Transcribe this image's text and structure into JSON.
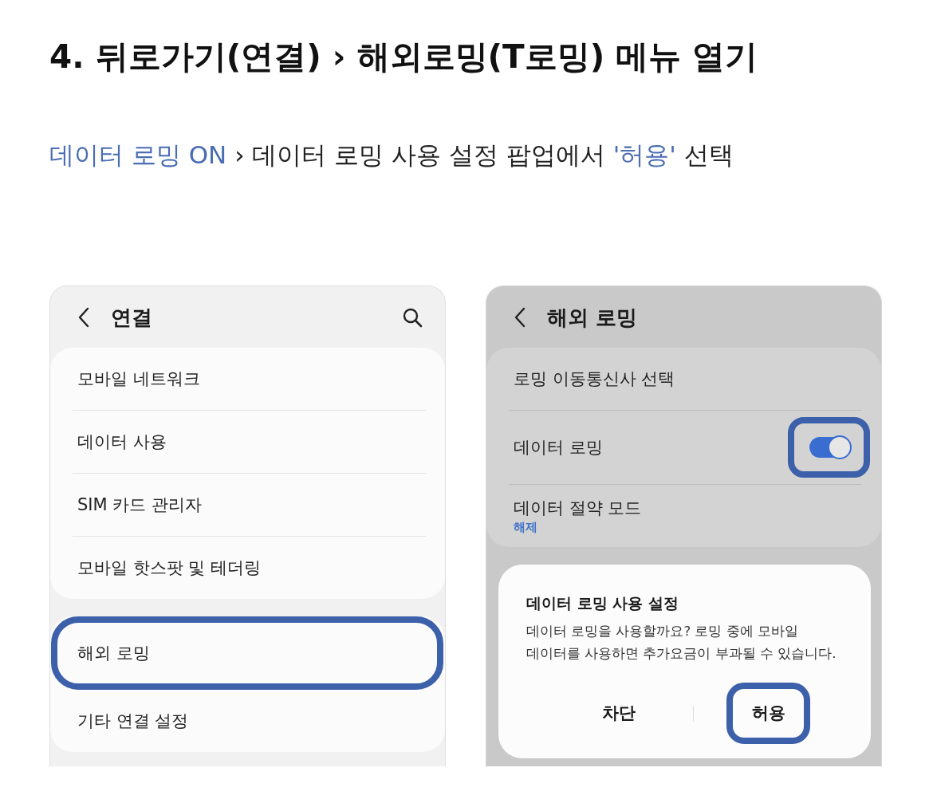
{
  "heading": "4. 뒤로가기(연결) › 해외로밍(T로밍) 메뉴 열기",
  "instruction": [
    {
      "text": "데이터 로밍 ON",
      "emphasis": true
    },
    {
      "text": "›",
      "emphasis": false
    },
    {
      "text": "데이터 로밍 사용 설정 팝업에서",
      "emphasis": false
    },
    {
      "text": "'허용'",
      "emphasis": true
    },
    {
      "text": "선택",
      "emphasis": false
    }
  ],
  "screens": [
    {
      "title": "연결",
      "search_button": true,
      "groups": [
        {
          "items": [
            {
              "label": "모바일 네트워크",
              "kind": "plain",
              "highlighted": false
            },
            {
              "label": "데이터 사용",
              "kind": "plain",
              "highlighted": false
            },
            {
              "label": "SIM 카드 관리자",
              "kind": "plain",
              "highlighted": false
            },
            {
              "label": "모바일 핫스팟 및 테더링",
              "kind": "plain",
              "highlighted": false
            }
          ]
        },
        {
          "items": [
            {
              "label": "해외 로밍",
              "kind": "plain",
              "highlighted": true
            },
            {
              "label": "기타 연결 설정",
              "kind": "plain",
              "highlighted": false
            }
          ]
        }
      ]
    },
    {
      "title": "해외 로밍",
      "search_button": false,
      "groups": [
        {
          "items": [
            {
              "label": "로밍 이동통신사 선택",
              "kind": "plain",
              "highlighted": false
            },
            {
              "label": "데이터 로밍",
              "kind": "switch",
              "highlighted": false,
              "switch": {
                "on": true,
                "highlighted": true
              }
            },
            {
              "label": "데이터 절약 모드",
              "kind": "plain",
              "sublabel": "해제",
              "highlighted": false
            }
          ]
        }
      ],
      "dialog": {
        "title": "데이터 로밍 사용 설정",
        "message": "데이터 로밍을 사용할까요? 로밍 중에 모바일 데이터를 사용하면 추가요금이 부과될 수 있습니다.",
        "buttons": [
          {
            "label": "차단",
            "highlighted": false
          },
          {
            "label": "허용",
            "highlighted": true
          }
        ]
      }
    }
  ]
}
